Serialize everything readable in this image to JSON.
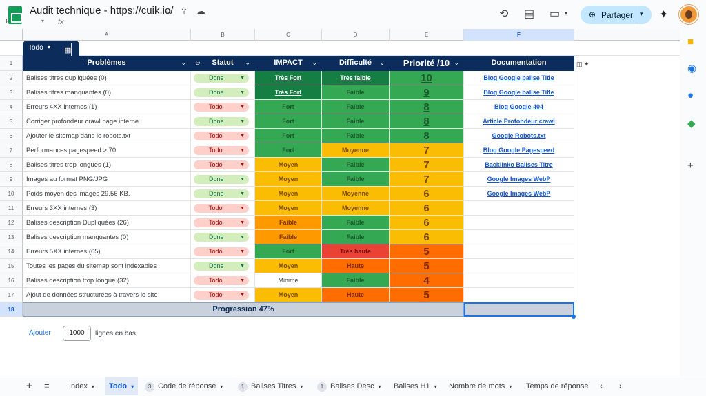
{
  "doc": {
    "title": "Audit technique - https://cuik.io/",
    "logo_letter": "F",
    "fx": "fx",
    "dropdown": "▾"
  },
  "toolbar_icons": {
    "star": "star-icon",
    "move": "move-icon",
    "cloud": "cloud-icon",
    "history": "history-icon",
    "comment": "comment-icon",
    "meet": "meet-icon",
    "gemini": "gemini-icon"
  },
  "share": {
    "label": "Partager"
  },
  "columns": [
    "A",
    "B",
    "C",
    "D",
    "E",
    "F"
  ],
  "table_chip": {
    "label": "Todo"
  },
  "headers": {
    "problemes": "Problèmes",
    "statut": "Statut",
    "impact": "IMPACT",
    "difficulte": "Difficulté",
    "priorite": "Priorité /10",
    "documentation": "Documentation"
  },
  "rows": [
    {
      "n": "2",
      "probleme": "Balises titres dupliquées (0)",
      "statut": "Done",
      "impact": "Très Fort",
      "difficulte": "Très faible",
      "priorite": "10",
      "doc": "Blog Google balise Title"
    },
    {
      "n": "3",
      "probleme": "Balises titres manquantes (0)",
      "statut": "Done",
      "impact": "Très Fort",
      "difficulte": "Faible",
      "priorite": "9",
      "doc": "Blog Google balise Title"
    },
    {
      "n": "4",
      "probleme": "Erreurs 4XX internes (1)",
      "statut": "Todo",
      "impact": "Fort",
      "difficulte": "Faible",
      "priorite": "8",
      "doc": "Blog Google 404"
    },
    {
      "n": "5",
      "probleme": "Corriger profondeur crawl page interne",
      "statut": "Done",
      "impact": "Fort",
      "difficulte": "Faible",
      "priorite": "8",
      "doc": "Article Profondeur crawl"
    },
    {
      "n": "6",
      "probleme": "Ajouter le sitemap dans le robots.txt",
      "statut": "Todo",
      "impact": "Fort",
      "difficulte": "Faible",
      "priorite": "8",
      "doc": "Google Robots.txt"
    },
    {
      "n": "7",
      "probleme": "Performances pagespeed > 70",
      "statut": "Todo",
      "impact": "Fort",
      "difficulte": "Moyenne",
      "priorite": "7",
      "doc": "Blog Google Pagespeed"
    },
    {
      "n": "8",
      "probleme": "Balises titres trop longues (1)",
      "statut": "Todo",
      "impact": "Moyen",
      "difficulte": "Faible",
      "priorite": "7",
      "doc": "Backlinko Balises Titre"
    },
    {
      "n": "9",
      "probleme": "Images au format PNG/JPG",
      "statut": "Done",
      "impact": "Moyen",
      "difficulte": "Faible",
      "priorite": "7",
      "doc": "Google Images WebP"
    },
    {
      "n": "10",
      "probleme": "Poids moyen des images 29.56 KB.",
      "statut": "Done",
      "impact": "Moyen",
      "difficulte": "Moyenne",
      "priorite": "6",
      "doc": "Google Images WebP"
    },
    {
      "n": "11",
      "probleme": "Erreurs 3XX internes (3)",
      "statut": "Todo",
      "impact": "Moyen",
      "difficulte": "Moyenne",
      "priorite": "6",
      "doc": ""
    },
    {
      "n": "12",
      "probleme": "Balises description Dupliquées (26)",
      "statut": "Todo",
      "impact": "Faible",
      "difficulte": "Faible",
      "priorite": "6",
      "doc": ""
    },
    {
      "n": "13",
      "probleme": "Balises description manquantes (0)",
      "statut": "Done",
      "impact": "Faible",
      "difficulte": "Faible",
      "priorite": "6",
      "doc": ""
    },
    {
      "n": "14",
      "probleme": "Erreurs 5XX internes (65)",
      "statut": "Todo",
      "impact": "Fort",
      "difficulte": "Très haute",
      "priorite": "5",
      "doc": ""
    },
    {
      "n": "15",
      "probleme": "Toutes les pages du sitemap sont indexables",
      "statut": "Done",
      "impact": "Moyen",
      "difficulte": "Haute",
      "priorite": "5",
      "doc": ""
    },
    {
      "n": "16",
      "probleme": "Balises description trop longue (32)",
      "statut": "Todo",
      "impact": "Minime",
      "difficulte": "Faible",
      "priorite": "4",
      "doc": ""
    },
    {
      "n": "17",
      "probleme": "Ajout de données structurées à travers le site",
      "statut": "Todo",
      "impact": "Moyen",
      "difficulte": "Haute",
      "priorite": "5",
      "doc": ""
    }
  ],
  "progress": {
    "n": "18",
    "label": "Progression 47%",
    "value": 0.47
  },
  "add_rows": {
    "button": "Ajouter",
    "count": "1000",
    "suffix": "lignes en bas"
  },
  "sheet_tabs": [
    {
      "label": "Index",
      "badge": ""
    },
    {
      "label": "Todo",
      "badge": "",
      "active": true
    },
    {
      "label": "Code de réponse",
      "badge": "3"
    },
    {
      "label": "Balises Titres",
      "badge": "1"
    },
    {
      "label": "Balises Desc",
      "badge": "1"
    },
    {
      "label": "Balises H1",
      "badge": ""
    },
    {
      "label": "Nombre de mots",
      "badge": ""
    },
    {
      "label": "Temps de réponse",
      "badge": ""
    }
  ],
  "colors": {
    "brand": "#0c2d5b",
    "accent": "#1a73e8",
    "done": "#d4edbc",
    "todo": "#ffcfc9"
  }
}
